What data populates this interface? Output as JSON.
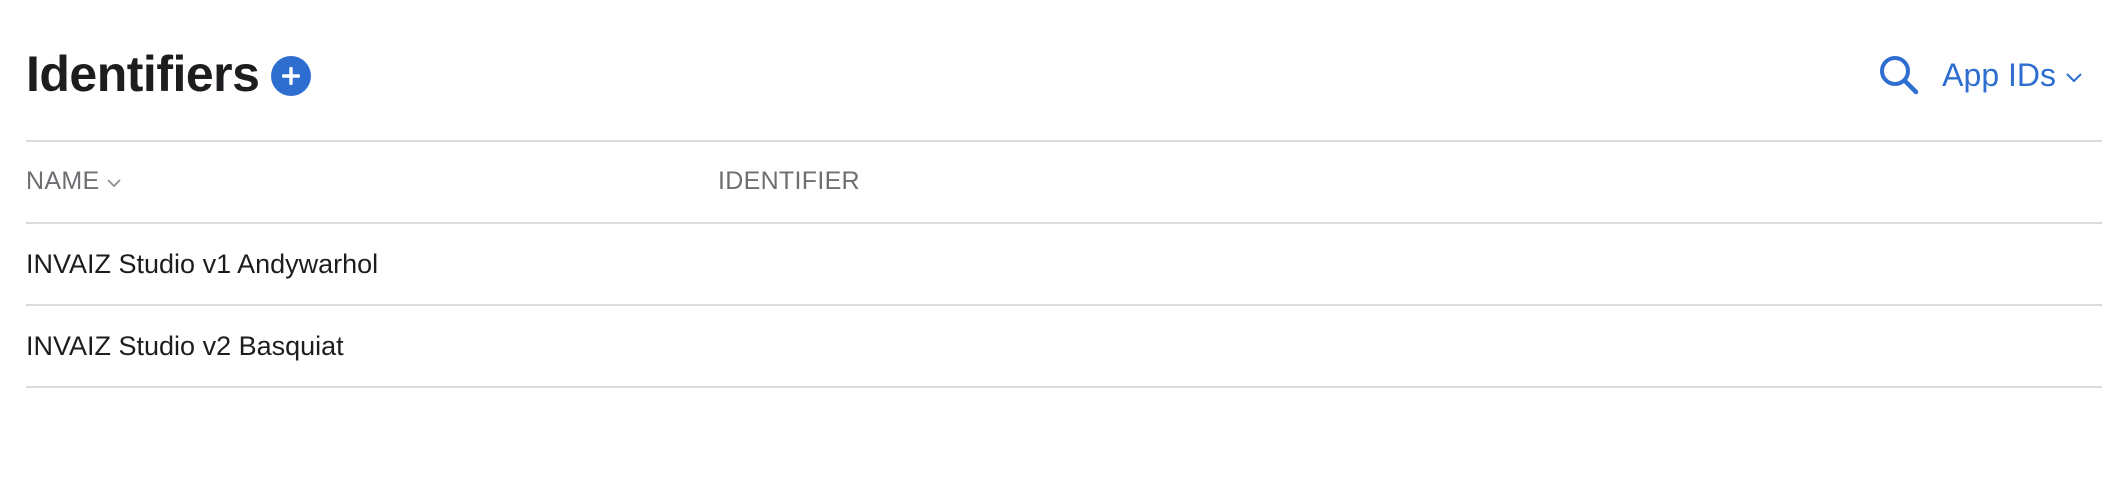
{
  "header": {
    "title": "Identifiers",
    "add_button_icon": "plus-circle-icon",
    "search_icon": "search-icon",
    "filter": {
      "selected": "App IDs",
      "icon": "chevron-down-icon"
    }
  },
  "table": {
    "columns": {
      "name": "NAME",
      "identifier": "IDENTIFIER"
    },
    "sort_icon": "chevron-down-icon",
    "rows": [
      {
        "name": "INVAIZ Studio v1 Andywarhol",
        "identifier": ""
      },
      {
        "name": "INVAIZ Studio v2 Basquiat",
        "identifier": ""
      }
    ]
  },
  "colors": {
    "accent": "#2f6ed1",
    "text_primary": "#1d1d1f",
    "text_secondary": "#6e6e73",
    "divider": "#dcdcdc"
  }
}
